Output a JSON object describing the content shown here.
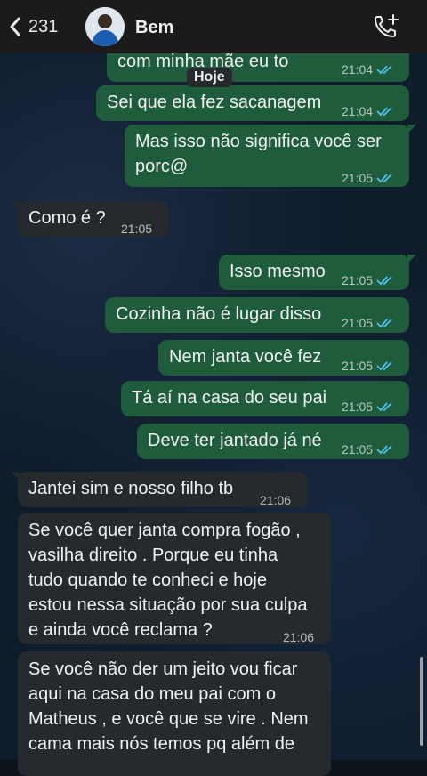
{
  "header": {
    "back_count": "231",
    "contact_name": "Bem"
  },
  "date_pill": "Hoje",
  "messages": [
    {
      "dir": "out",
      "text": "com minha mãe eu to",
      "time": "21:04"
    },
    {
      "dir": "out",
      "text": "Sei que ela fez sacanagem",
      "time": "21:04"
    },
    {
      "dir": "out",
      "text": "Mas isso não significa você ser\nporc@",
      "time": "21:05"
    },
    {
      "dir": "in",
      "text": "Como é ?",
      "time": "21:05"
    },
    {
      "dir": "out",
      "text": "Isso mesmo",
      "time": "21:05"
    },
    {
      "dir": "out",
      "text": "Cozinha não é lugar disso",
      "time": "21:05"
    },
    {
      "dir": "out",
      "text": "Nem janta você fez",
      "time": "21:05"
    },
    {
      "dir": "out",
      "text": "Tá aí na casa do seu pai",
      "time": "21:05"
    },
    {
      "dir": "out",
      "text": "Deve ter jantado já né",
      "time": "21:05"
    },
    {
      "dir": "in",
      "text": "Jantei sim e nosso filho tb",
      "time": "21:06"
    },
    {
      "dir": "in",
      "text": "Se você quer janta compra fogão ,\nvasilha direito . Porque eu tinha\ntudo quando te conheci e hoje\nestou nessa situação por sua culpa\ne ainda você reclama ?",
      "time": "21:06"
    },
    {
      "dir": "in",
      "text": "Se você não der um jeito vou ficar\naqui na casa do meu pai com o\nMatheus , e você que se vire . Nem\ncama mais nós temos pq além de",
      "time": ""
    }
  ],
  "colors": {
    "outgoing_bubble": "#1f5c3c",
    "incoming_bubble": "#262a2e",
    "read_ticks": "#53bdeb"
  },
  "icons": [
    "chevron-left-icon",
    "avatar",
    "add-call-icon",
    "double-check-icon"
  ]
}
